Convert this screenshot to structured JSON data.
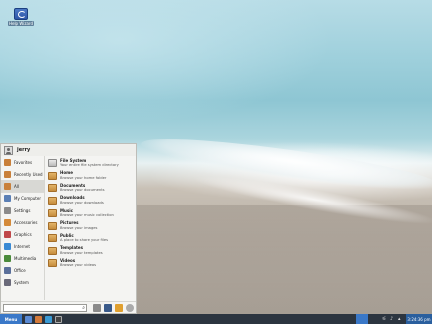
{
  "desktop": {
    "icon_label": "Help Wizard"
  },
  "menu": {
    "user": "jerry",
    "categories": [
      {
        "label": "Favorites",
        "icon": "favorites-icon",
        "color": "#c9803a"
      },
      {
        "label": "Recently Used",
        "icon": "recent-icon",
        "color": "#c9803a"
      },
      {
        "label": "All",
        "icon": "all-icon",
        "color": "#c9803a"
      },
      {
        "label": "My Computer",
        "icon": "computer-icon",
        "color": "#5a7fb5"
      },
      {
        "label": "Settings",
        "icon": "settings-icon",
        "color": "#8a8a8a"
      },
      {
        "label": "Accessories",
        "icon": "accessories-icon",
        "color": "#d48a3a"
      },
      {
        "label": "Graphics",
        "icon": "graphics-icon",
        "color": "#c0484a"
      },
      {
        "label": "Internet",
        "icon": "internet-icon",
        "color": "#3a8ad4"
      },
      {
        "label": "Multimedia",
        "icon": "multimedia-icon",
        "color": "#4a8a3a"
      },
      {
        "label": "Office",
        "icon": "office-icon",
        "color": "#5a6f9a"
      },
      {
        "label": "System",
        "icon": "system-icon",
        "color": "#6a6a7a"
      }
    ],
    "apps": [
      {
        "title": "File System",
        "desc": "Your entire file system directory",
        "icon": "drive-icon"
      },
      {
        "title": "Home",
        "desc": "Browse your home folder",
        "icon": "home-folder-icon"
      },
      {
        "title": "Documents",
        "desc": "Browse your documents",
        "icon": "documents-folder-icon"
      },
      {
        "title": "Downloads",
        "desc": "Browse your downloads",
        "icon": "downloads-folder-icon"
      },
      {
        "title": "Music",
        "desc": "Browse your music collection",
        "icon": "music-folder-icon"
      },
      {
        "title": "Pictures",
        "desc": "Browse your images",
        "icon": "pictures-folder-icon"
      },
      {
        "title": "Public",
        "desc": "A place to share your files",
        "icon": "public-folder-icon"
      },
      {
        "title": "Templates",
        "desc": "Browse your templates",
        "icon": "templates-folder-icon"
      },
      {
        "title": "Videos",
        "desc": "Browse your videos",
        "icon": "videos-folder-icon"
      }
    ],
    "search_placeholder": ""
  },
  "taskbar": {
    "start_label": "Menu",
    "clock": "3:24:36 pm"
  },
  "colors": {
    "accent": "#3a78c8",
    "taskbar": "#2c3540"
  }
}
